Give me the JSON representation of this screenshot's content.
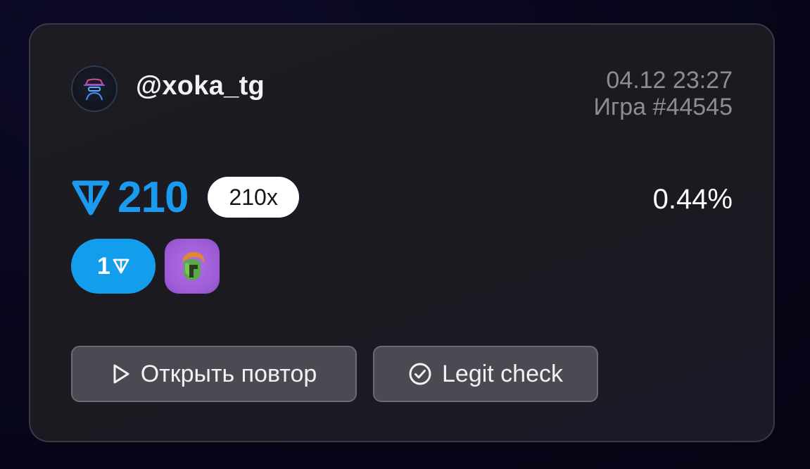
{
  "user": {
    "avatar_icon": "hacker-avatar-icon",
    "username": "@xoka_tg"
  },
  "game": {
    "datetime": "04.12 23:27",
    "label": "Игра #44545"
  },
  "win": {
    "currency_icon": "ton-icon",
    "amount": "210",
    "multiplier": "210x",
    "chance": "0.44%"
  },
  "bet": {
    "amount": "1",
    "currency_icon": "ton-icon",
    "gift_icon": "spartan-helmet-icon"
  },
  "actions": {
    "replay_label": "Открыть повтор",
    "replay_icon": "play-icon",
    "legit_label": "Legit check",
    "legit_icon": "check-circle-icon"
  },
  "colors": {
    "accent": "#1a9bf0",
    "gift_bg": "#9d5bd6",
    "card_bg": "#1c1c22"
  }
}
